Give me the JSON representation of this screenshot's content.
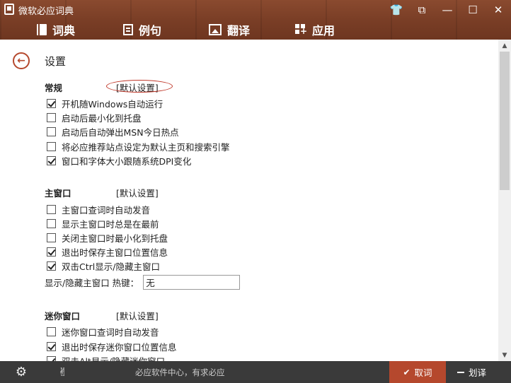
{
  "window": {
    "title": "微软必应词典",
    "controls": [
      {
        "name": "skin-icon",
        "glyph": "👕"
      },
      {
        "name": "mini-mode-icon",
        "glyph": "⧉"
      },
      {
        "name": "minimize-icon",
        "glyph": "—"
      },
      {
        "name": "maximize-icon",
        "glyph": "☐"
      },
      {
        "name": "close-icon",
        "glyph": "✕"
      }
    ]
  },
  "nav": {
    "dictionary": "词典",
    "examples": "例句",
    "translate": "翻译",
    "apps": "应用"
  },
  "settings": {
    "title": "设置",
    "back_glyph": "←",
    "reset_label": "[默认设置]",
    "general": {
      "title": "常规",
      "options": [
        {
          "label": "开机随Windows自动运行",
          "checked": true
        },
        {
          "label": "启动后最小化到托盘",
          "checked": false
        },
        {
          "label": "启动后自动弹出MSN今日热点",
          "checked": false
        },
        {
          "label": "将必应推荐站点设定为默认主页和搜索引擎",
          "checked": false
        },
        {
          "label": "窗口和字体大小跟随系统DPI变化",
          "checked": true
        }
      ]
    },
    "main_window": {
      "title": "主窗口",
      "options": [
        {
          "label": "主窗口查词时自动发音",
          "checked": false
        },
        {
          "label": "显示主窗口时总是在最前",
          "checked": false
        },
        {
          "label": "关闭主窗口时最小化到托盘",
          "checked": false
        },
        {
          "label": "退出时保存主窗口位置信息",
          "checked": true
        },
        {
          "label": "双击Ctrl显示/隐藏主窗口",
          "checked": true
        }
      ],
      "hotkey_label": "显示/隐藏主窗口 热键：",
      "hotkey_value": "无"
    },
    "mini_window": {
      "title": "迷你窗口",
      "options": [
        {
          "label": "迷你窗口查词时自动发音",
          "checked": false
        },
        {
          "label": "退出时保存迷你窗口位置信息",
          "checked": true
        },
        {
          "label": "双击Alt显示/隐藏迷你窗口",
          "checked": true
        }
      ]
    }
  },
  "bottom": {
    "slogan": "必应软件中心，有求必应",
    "cancel": "取词",
    "translate": "划译"
  },
  "colors": {
    "accent": "#b5482d",
    "header_wood": "#7a3e26",
    "bottom_bar": "#3a3a3a"
  }
}
